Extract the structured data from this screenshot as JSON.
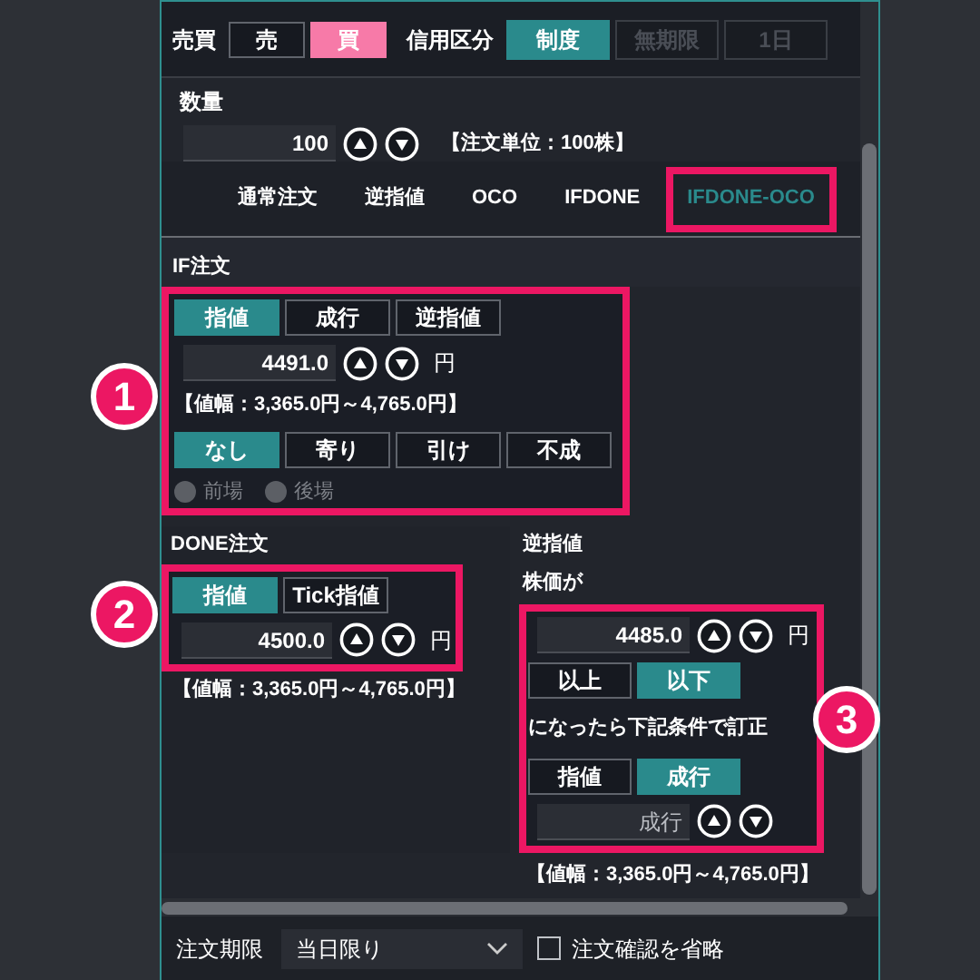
{
  "trade_side": {
    "label": "売買",
    "options": [
      {
        "label": "売",
        "selected": false
      },
      {
        "label": "買",
        "selected": true
      }
    ]
  },
  "credit_type": {
    "label": "信用区分",
    "options": [
      {
        "label": "制度",
        "selected": true,
        "disabled": false
      },
      {
        "label": "無期限",
        "selected": false,
        "disabled": true
      },
      {
        "label": "1日",
        "selected": false,
        "disabled": true
      }
    ]
  },
  "quantity": {
    "label": "数量",
    "value": "100",
    "note": "【注文単位：100株】"
  },
  "tabs": [
    {
      "label": "通常注文",
      "selected": false,
      "highlighted": false
    },
    {
      "label": "逆指値",
      "selected": false,
      "highlighted": false
    },
    {
      "label": "OCO",
      "selected": false,
      "highlighted": false
    },
    {
      "label": "IFDONE",
      "selected": false,
      "highlighted": false
    },
    {
      "label": "IFDONE-OCO",
      "selected": true,
      "highlighted": true
    }
  ],
  "if_order": {
    "title": "IF注文",
    "highlighted": true,
    "types": [
      {
        "label": "指値",
        "selected": true
      },
      {
        "label": "成行",
        "selected": false
      },
      {
        "label": "逆指値",
        "selected": false
      }
    ],
    "price": "4491.0",
    "unit": "円",
    "range": "【値幅：3,365.0円～4,765.0円】",
    "conditions": [
      {
        "label": "なし",
        "selected": true
      },
      {
        "label": "寄り",
        "selected": false
      },
      {
        "label": "引け",
        "selected": false
      },
      {
        "label": "不成",
        "selected": false
      }
    ],
    "sessions": [
      {
        "label": "前場",
        "selected": false,
        "disabled": true
      },
      {
        "label": "後場",
        "selected": false,
        "disabled": true
      }
    ]
  },
  "done_order": {
    "title": "DONE注文",
    "highlighted": true,
    "types": [
      {
        "label": "指値",
        "selected": true
      },
      {
        "label": "Tick指値",
        "selected": false
      }
    ],
    "price": "4500.0",
    "unit": "円",
    "range": "【値幅：3,365.0円～4,765.0円】"
  },
  "stop_order": {
    "title": "逆指値",
    "trigger_label": "株価が",
    "highlighted": true,
    "trigger_price": "4485.0",
    "unit": "円",
    "directions": [
      {
        "label": "以上",
        "selected": false
      },
      {
        "label": "以下",
        "selected": true
      }
    ],
    "then_label": "になったら下記条件で訂正",
    "types": [
      {
        "label": "指値",
        "selected": false
      },
      {
        "label": "成行",
        "selected": true
      }
    ],
    "price": "成行",
    "range": "【値幅：3,365.0円～4,765.0円】"
  },
  "footer": {
    "expiry_label": "注文期限",
    "expiry_value": "当日限り",
    "skip_confirm": {
      "label": "注文確認を省略",
      "checked": false
    }
  },
  "annotations": [
    {
      "label": "1"
    },
    {
      "label": "2"
    },
    {
      "label": "3"
    }
  ]
}
